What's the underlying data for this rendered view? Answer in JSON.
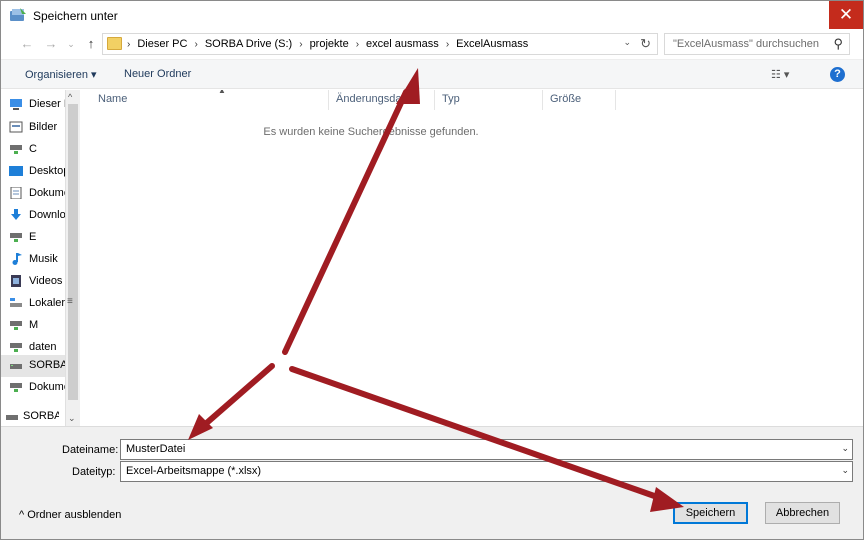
{
  "window": {
    "title": "Speichern unter",
    "close_glyph": "✕"
  },
  "navigation": {
    "back_glyph": "←",
    "forward_glyph": "→",
    "recent_glyph": "⌄",
    "up_glyph": "↑"
  },
  "address": {
    "crumbs": [
      "Dieser PC",
      "SORBA Drive (S:)",
      "projekte",
      "excel ausmass",
      "ExcelAusmass"
    ],
    "separator": "›",
    "dropdown_glyph": "⌄",
    "refresh_glyph": "↻"
  },
  "search": {
    "placeholder": "\"ExcelAusmass\" durchsuchen",
    "icon_glyph": "⚲"
  },
  "commands": {
    "organize": "Organisieren ▾",
    "new_folder": "Neuer Ordner",
    "view_glyph": "☷ ▾",
    "help_glyph": "?"
  },
  "nav_pane": {
    "items": [
      {
        "label": "Dieser PC",
        "icon": "pc-icon"
      },
      {
        "label": "Bilder",
        "icon": "pictures-icon"
      },
      {
        "label": "C",
        "icon": "network-drive-icon"
      },
      {
        "label": "Desktop",
        "icon": "desktop-icon"
      },
      {
        "label": "Dokumente",
        "icon": "documents-icon"
      },
      {
        "label": "Downloads",
        "icon": "downloads-icon"
      },
      {
        "label": "E",
        "icon": "network-drive-icon"
      },
      {
        "label": "Musik",
        "icon": "music-icon"
      },
      {
        "label": "Videos",
        "icon": "videos-icon"
      },
      {
        "label": "Lokaler Datenträger",
        "icon": "local-disk-icon"
      },
      {
        "label": "M",
        "icon": "network-drive-icon"
      },
      {
        "label": "daten",
        "icon": "network-drive-icon"
      },
      {
        "label": "SORBA Drive (S:)",
        "icon": "drive-icon"
      },
      {
        "label": "Dokumente",
        "icon": "network-drive-icon"
      },
      {
        "label": "SORBA",
        "icon": "drive-icon"
      }
    ],
    "selected_index": 12,
    "scroll_up_glyph": "^",
    "scroll_down_glyph": "⌄",
    "scroll_grip_glyph": "≡"
  },
  "file_list": {
    "columns": [
      "Name",
      "Änderungsdatum",
      "Typ",
      "Größe"
    ],
    "sort_glyph": "▲",
    "empty_message": "Es wurden keine Suchergebnisse gefunden."
  },
  "form": {
    "filename_label": "Dateiname:",
    "filename_value": "MusterDatei",
    "filetype_label": "Dateityp:",
    "filetype_value": "Excel-Arbeitsmappe (*.xlsx)",
    "dropdown_glyph": "⌄",
    "hide_folders": "^ Ordner ausblenden",
    "save_button": "Speichern",
    "cancel_button": "Abbrechen"
  },
  "colors": {
    "close_button": "#c42b1c",
    "annotation_arrow": "#a01c22",
    "help_icon": "#1e6fd0",
    "default_button_border": "#0078d7"
  }
}
